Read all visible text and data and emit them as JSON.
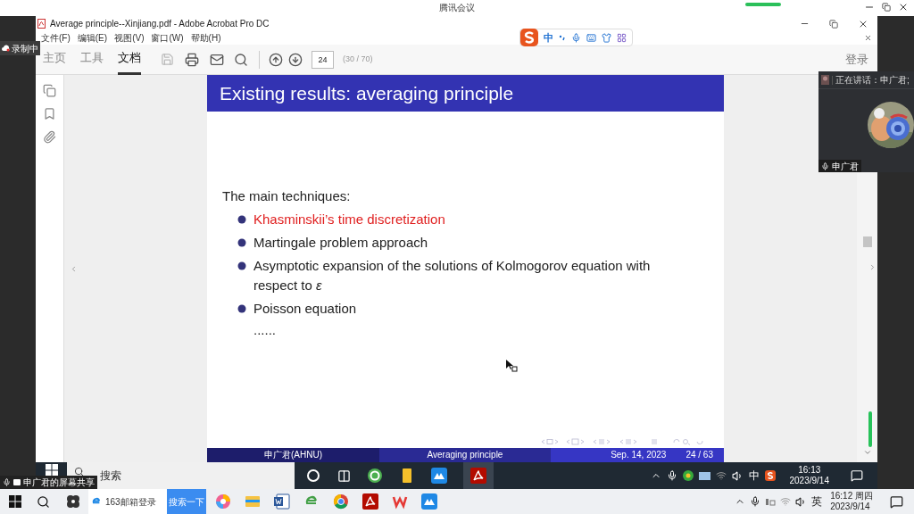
{
  "meeting_window": {
    "title": "腾讯会议",
    "recording_badge": "录制中",
    "share_label": "申广君的屏幕共享"
  },
  "acrobat": {
    "title": "Average principle--Xinjiang.pdf - Adobe Acrobat Pro DC",
    "menu": [
      "文件(F)",
      "编辑(E)",
      "视图(V)",
      "窗口(W)",
      "帮助(H)"
    ],
    "tabs": [
      {
        "label": "主页",
        "selected": false
      },
      {
        "label": "工具",
        "selected": false
      },
      {
        "label": "文档",
        "selected": true
      }
    ],
    "page_field": {
      "value": "24"
    },
    "page_count": "(30 / 70)",
    "login": "登录"
  },
  "slide": {
    "title": "Existing results: averaging principle",
    "intro": "The main techniques:",
    "bullets": [
      {
        "text": "Khasminskii’s time discretization",
        "highlighted": true
      },
      {
        "text": "Martingale problem approach",
        "highlighted": false
      },
      {
        "text": "Asymptotic expansion of the solutions of Kolmogorov equation with respect to *ε*",
        "highlighted": false
      },
      {
        "text": "Poisson equation",
        "highlighted": false
      }
    ],
    "ellipsis": "......",
    "footer": {
      "author": "申广君(AHNU)",
      "short_title": "Averaging principle",
      "date": "Sep. 14, 2023",
      "page": "24 / 63"
    }
  },
  "ime_toolbar": {
    "mode": "中"
  },
  "video_panel": {
    "speaking": "正在讲话：申广君;",
    "name": "申广君"
  },
  "shared_taskbar": {
    "search": "搜索",
    "ime": "中",
    "time": "16:13",
    "date": "2023/9/14"
  },
  "taskbar": {
    "browser_tab": "163邮箱登录",
    "search_button": "搜索一下",
    "ime": "英",
    "time": "16:12 周四",
    "date": "2023/9/14"
  }
}
